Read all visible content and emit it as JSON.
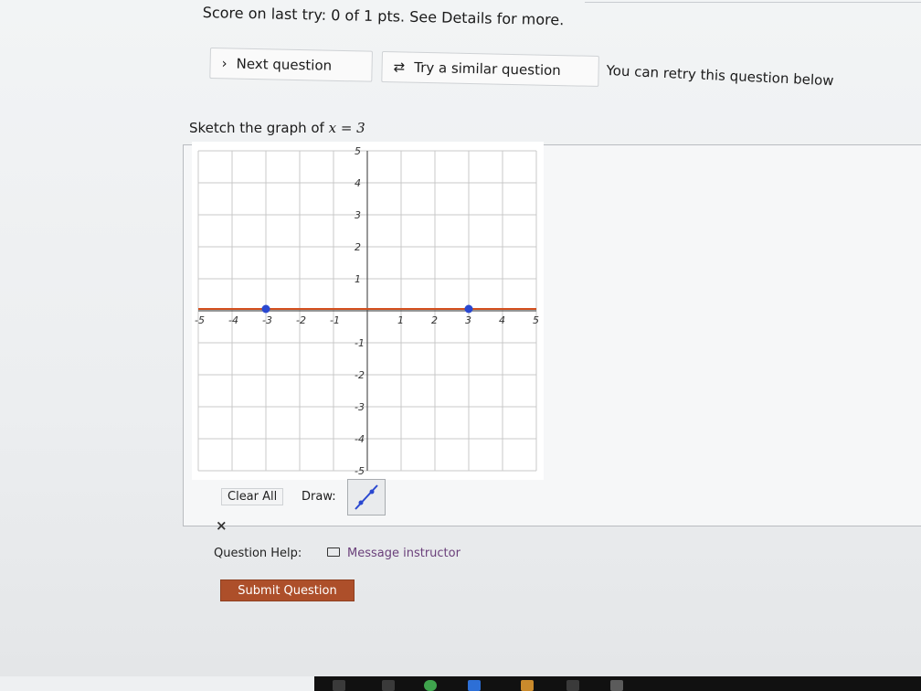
{
  "score_text": "Score on last try: 0 of 1 pts. See Details for more.",
  "buttons": {
    "next_question": "Next question",
    "try_similar": "Try a similar question"
  },
  "retry_text": "You can retry this question below",
  "question": {
    "prefix": "Sketch the graph of",
    "equation": "x = 3"
  },
  "graph": {
    "x_ticks": [
      "-5",
      "-4",
      "-3",
      "-2",
      "-1",
      "1",
      "2",
      "3",
      "4",
      "5"
    ],
    "y_ticks": [
      "5",
      "4",
      "3",
      "2",
      "1",
      "-1",
      "-2",
      "-3",
      "-4",
      "-5"
    ],
    "drawn_line": {
      "y": 0,
      "points": [
        [
          -3,
          0
        ],
        [
          3,
          0
        ]
      ]
    },
    "line_color": "#d4501f",
    "point_color": "#2a48d0"
  },
  "toolbar": {
    "clear_all": "Clear All",
    "draw_label": "Draw:"
  },
  "close_symbol": "×",
  "help": {
    "label": "Question Help:",
    "message_instructor": "Message instructor"
  },
  "submit": "Submit Question",
  "colors": {
    "submit_bg": "#ad4f2a",
    "link": "#6a3f7a"
  }
}
